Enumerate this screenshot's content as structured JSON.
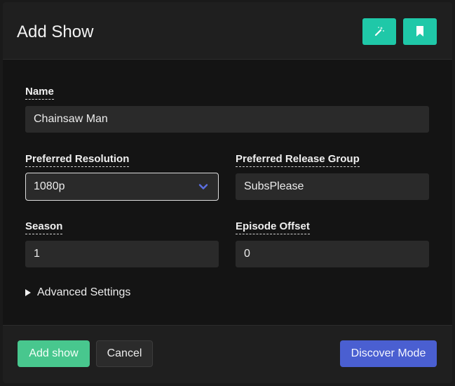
{
  "dialog": {
    "title": "Add Show"
  },
  "header_actions": {
    "magic": {
      "icon": "magic-wand-icon"
    },
    "bookmark": {
      "icon": "bookmark-icon"
    }
  },
  "form": {
    "name": {
      "label": "Name",
      "value": "Chainsaw Man"
    },
    "resolution": {
      "label": "Preferred Resolution",
      "value": "1080p"
    },
    "release_group": {
      "label": "Preferred Release Group",
      "value": "SubsPlease"
    },
    "season": {
      "label": "Season",
      "value": "1"
    },
    "episode_offset": {
      "label": "Episode Offset",
      "value": "0"
    },
    "advanced": {
      "label": "Advanced Settings"
    }
  },
  "footer": {
    "add_label": "Add show",
    "cancel_label": "Cancel",
    "discover_label": "Discover Mode"
  },
  "colors": {
    "accent_teal": "#1fc8a8",
    "add_green": "#48c78e",
    "discover_blue": "#4a5fd1",
    "chevron_blue": "#5b6ee1"
  }
}
